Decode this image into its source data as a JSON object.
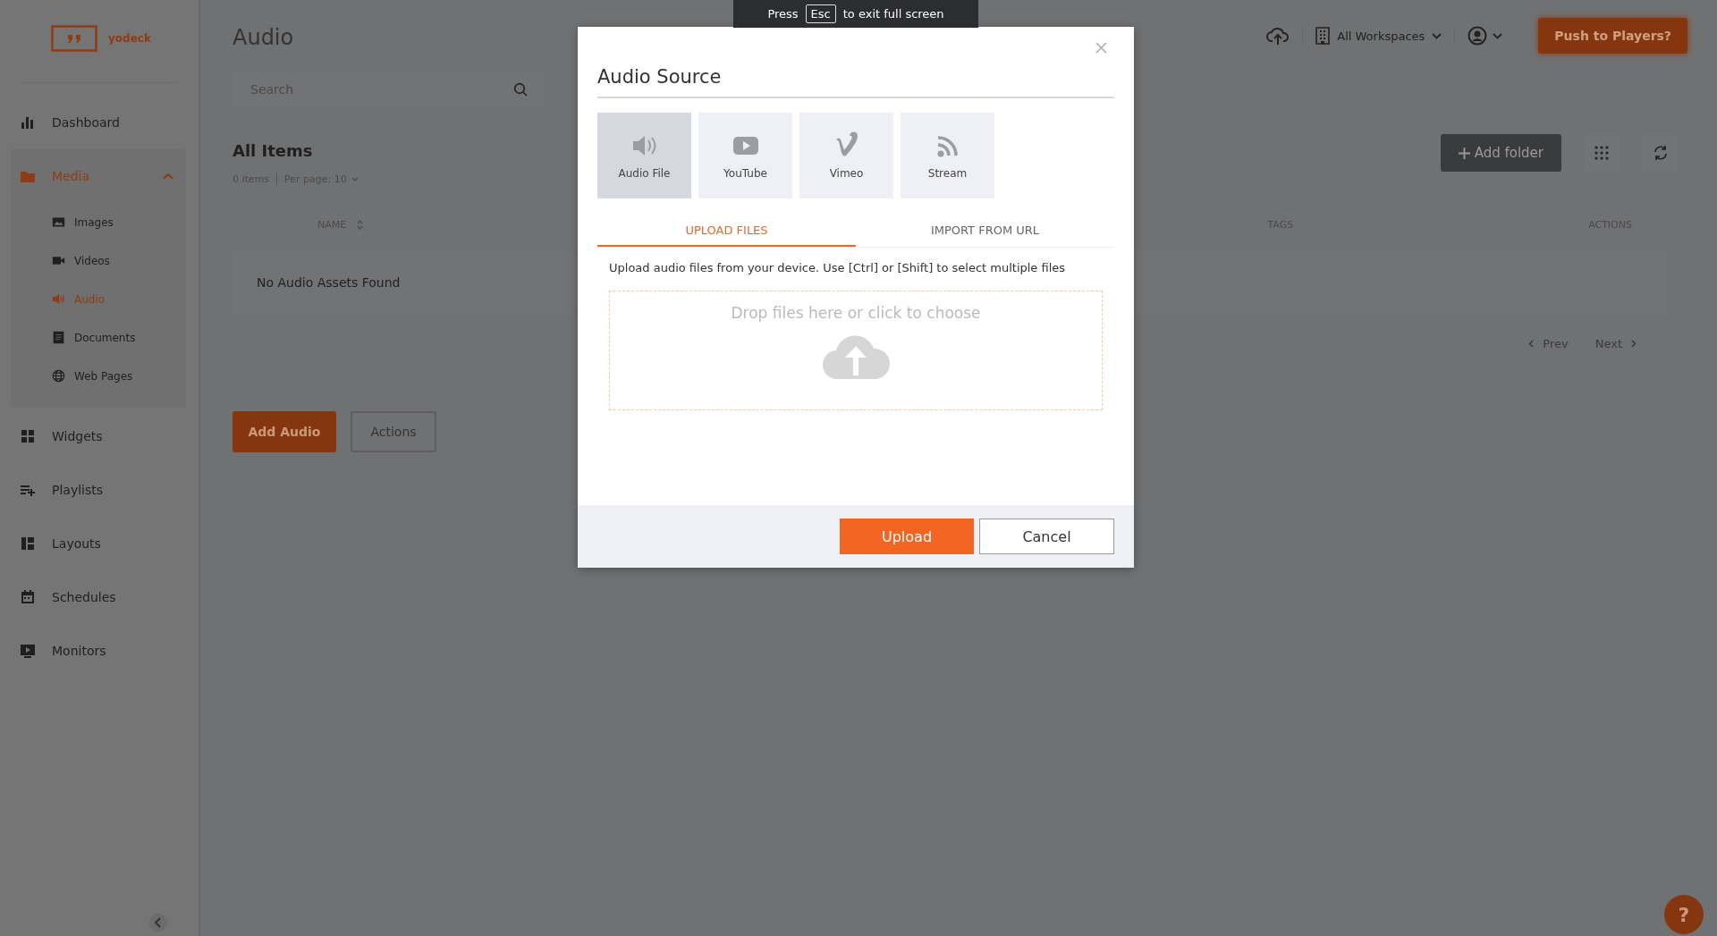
{
  "fullscreen_notice": {
    "before": "Press",
    "key": "Esc",
    "after": "to exit full screen"
  },
  "sidebar": {
    "logo": "yodeck",
    "items": [
      {
        "label": "Dashboard",
        "selected": false
      },
      {
        "label": "Media",
        "selected": true,
        "expanded": true,
        "children": [
          {
            "label": "Images",
            "selected": false
          },
          {
            "label": "Videos",
            "selected": false
          },
          {
            "label": "Audio",
            "selected": true
          },
          {
            "label": "Documents",
            "selected": false
          },
          {
            "label": "Web Pages",
            "selected": false
          }
        ]
      },
      {
        "label": "Widgets",
        "selected": false
      },
      {
        "label": "Playlists",
        "selected": false
      },
      {
        "label": "Layouts",
        "selected": false
      },
      {
        "label": "Schedules",
        "selected": false
      },
      {
        "label": "Monitors",
        "selected": false
      }
    ]
  },
  "header": {
    "page_title": "Audio",
    "workspace": "All Workspaces",
    "push_button": "Push to Players?"
  },
  "search": {
    "placeholder": "Search"
  },
  "list": {
    "title": "All Items",
    "count": "0 items",
    "per_page": "Per page: 10",
    "add_folder": "Add folder",
    "columns": [
      "NAME",
      "TAGS",
      "ACTIONS"
    ],
    "empty_message": "No Audio Assets Found",
    "prev": "Prev",
    "next": "Next"
  },
  "buttons": {
    "add": "Add Audio",
    "actions": "Actions"
  },
  "modal": {
    "title": "Audio Source",
    "sources": [
      {
        "label": "Audio File",
        "selected": true
      },
      {
        "label": "YouTube",
        "selected": false
      },
      {
        "label": "Vimeo",
        "selected": false
      },
      {
        "label": "Stream",
        "selected": false
      }
    ],
    "tabs": [
      {
        "label": "UPLOAD FILES",
        "selected": true
      },
      {
        "label": "IMPORT FROM URL",
        "selected": false
      }
    ],
    "description": "Upload audio files from your device. Use [Ctrl] or [Shift] to select multiple files",
    "dropzone": "Drop files here or click to choose",
    "buttons": {
      "primary": "Upload",
      "secondary": "Cancel"
    }
  },
  "help": "?"
}
